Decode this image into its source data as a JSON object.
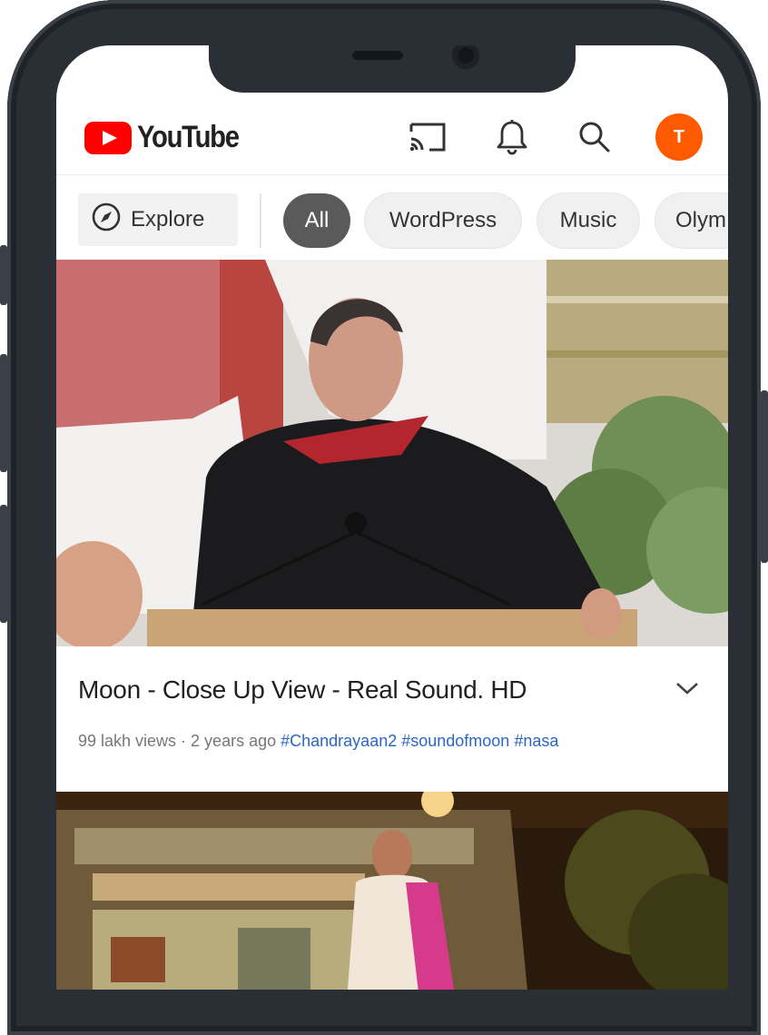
{
  "app": {
    "name": "YouTube"
  },
  "header": {
    "logo_text": "YouTube",
    "icons": [
      "cast-icon",
      "bell-icon",
      "search-icon"
    ],
    "avatar_initial": "T",
    "avatar_color": "#ff5a00"
  },
  "chips": {
    "explore_label": "Explore",
    "items": [
      {
        "label": "All",
        "active": true
      },
      {
        "label": "WordPress",
        "active": false
      },
      {
        "label": "Music",
        "active": false
      },
      {
        "label": "Olym",
        "active": false
      }
    ]
  },
  "videos": [
    {
      "title": "Moon - Close Up View - Real Sound. HD",
      "meta": "99 lakh views · 2 years ago ",
      "tags": "#Chandrayaan2 #soundofmoon #nasa"
    }
  ],
  "colors": {
    "brand_red": "#ff0000",
    "link_blue": "#2a66c8",
    "active_chip": "#5a5a5a"
  }
}
